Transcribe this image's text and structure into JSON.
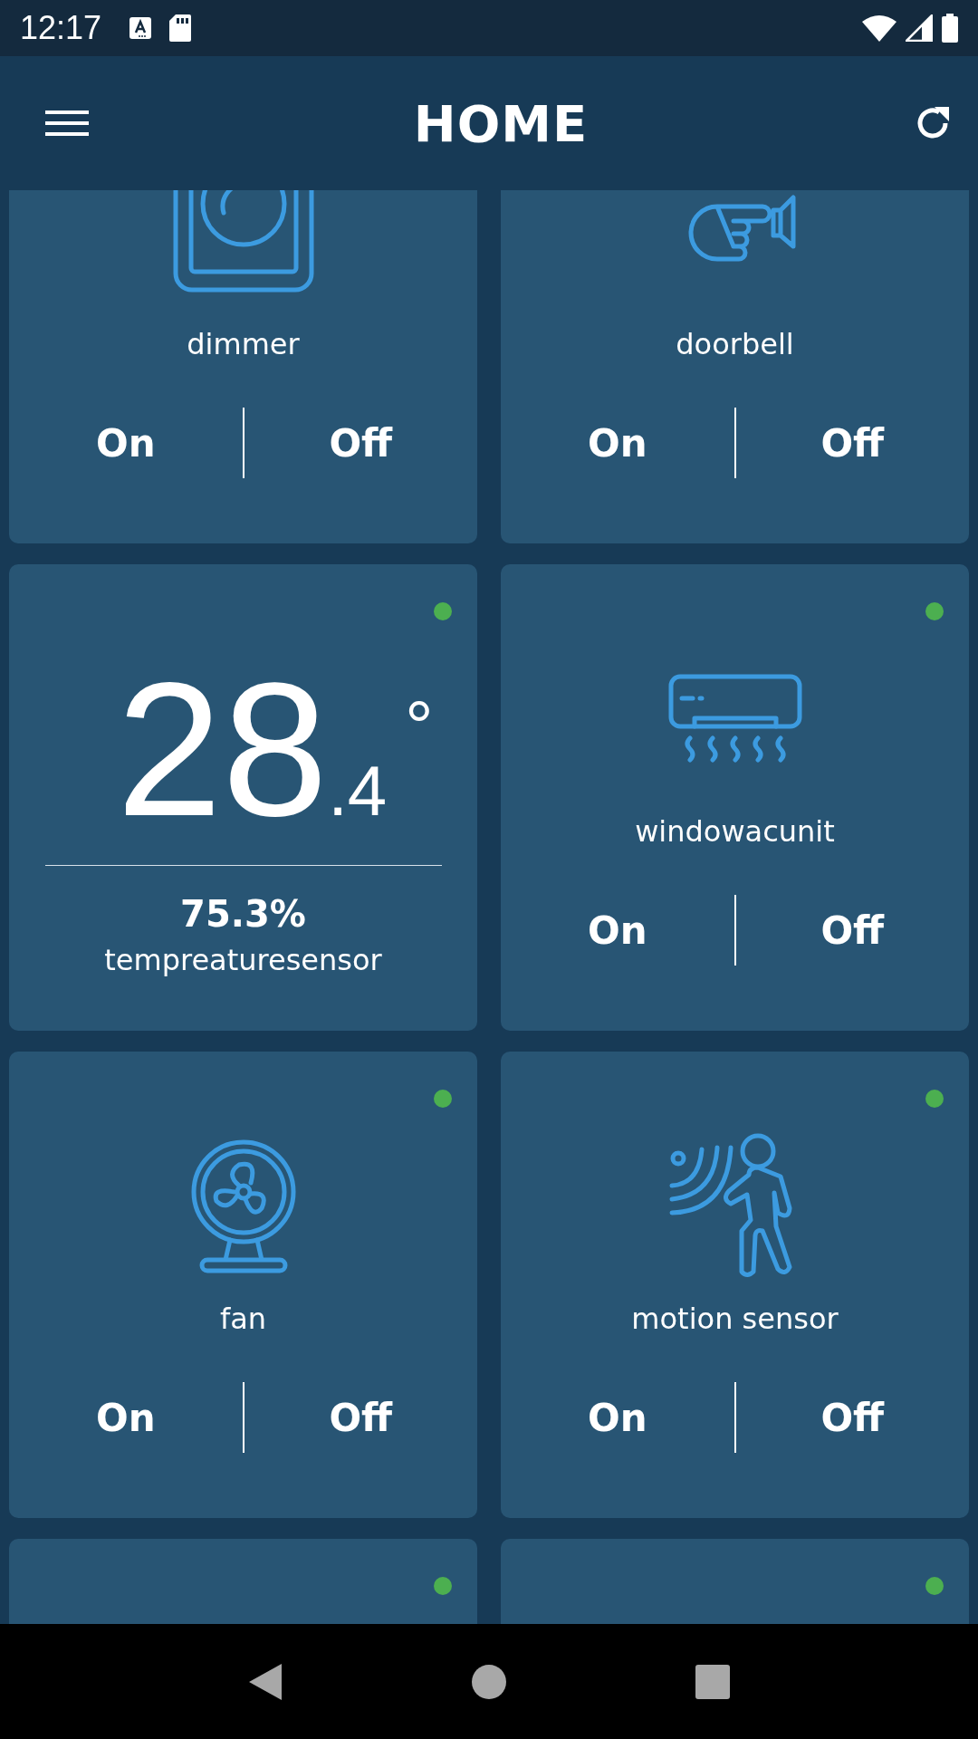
{
  "status_bar": {
    "time": "12:17"
  },
  "app_bar": {
    "title": "HOME"
  },
  "devices": [
    {
      "kind": "switch",
      "name": "dimmer",
      "on_label": "On",
      "off_label": "Off"
    },
    {
      "kind": "switch",
      "name": "doorbell",
      "on_label": "On",
      "off_label": "Off"
    },
    {
      "kind": "sensor",
      "online": true,
      "temperature": "28",
      "decimal": ".4",
      "unit": "°",
      "humidity": "75.3%",
      "name": "tempreaturesensor"
    },
    {
      "kind": "switch",
      "online": true,
      "name": "windowacunit",
      "on_label": "On",
      "off_label": "Off"
    },
    {
      "kind": "switch",
      "online": true,
      "name": "fan",
      "on_label": "On",
      "off_label": "Off"
    },
    {
      "kind": "switch",
      "online": true,
      "name": "motion sensor",
      "on_label": "On",
      "off_label": "Off"
    },
    {
      "kind": "switch",
      "online": true
    },
    {
      "kind": "switch",
      "online": true
    }
  ]
}
